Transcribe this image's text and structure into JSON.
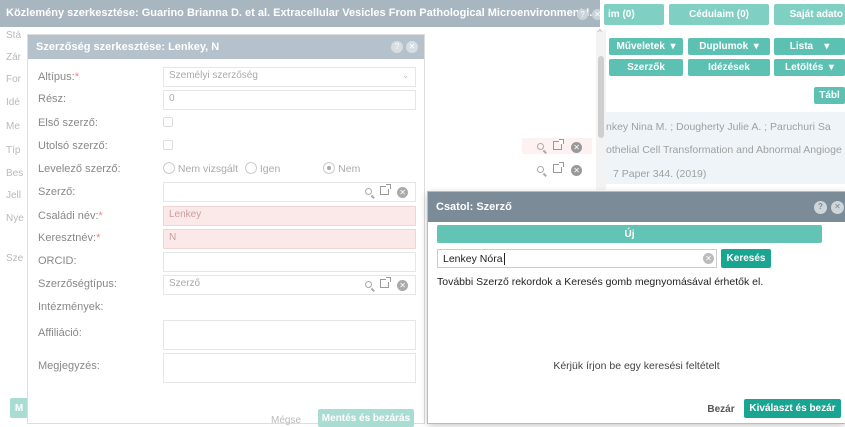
{
  "main_title": "Közlemény szerkesztése: Guarino Brianna D. et al. Extracellular Vesicles From Pathological Microenvironment I...",
  "top_tabs": [
    "im (0)",
    "Cédulaim (0)",
    "Saját adato"
  ],
  "toolbar_row1": [
    "Műveletek",
    "Duplumok",
    "Lista"
  ],
  "toolbar_row2": [
    "Szerzők",
    "Idézések",
    "Letöltés"
  ],
  "table_btn": "Tábl",
  "left_labels": [
    "Stá",
    "Zár",
    "For",
    "Idé",
    "Me",
    "Típ",
    "Bes",
    "Jell",
    "Nye",
    "Sze"
  ],
  "left_bottom_btn": "M",
  "content_lines": [
    "nkey Nina M. ;  Dougherty Julie A. ;  Paruchuri Sa",
    "othelial Cell Transformation and Abnormal Angioge",
    "7  Paper 344. (2019)"
  ],
  "author_dialog": {
    "title": "Szerzőség szerkesztése: Lenkey, N",
    "rows": {
      "altipus": {
        "label": "Altípus:",
        "value": "Személyi szerzőség"
      },
      "resz": {
        "label": "Rész:",
        "value": "0"
      },
      "elso": {
        "label": "Első szerző:"
      },
      "utolso": {
        "label": "Utolsó szerző:"
      },
      "levelezo": {
        "label": "Levelező szerző:",
        "options": [
          "Nem vizsgált",
          "Igen",
          "Nem"
        ]
      },
      "szerzo": {
        "label": "Szerző:"
      },
      "csaladi": {
        "label": "Családi név:",
        "value": "Lenkey"
      },
      "kereszt": {
        "label": "Keresztnév:",
        "value": "N"
      },
      "orcid": {
        "label": "ORCID:"
      },
      "tipus": {
        "label": "Szerzőségtípus:",
        "value": "Szerző"
      },
      "intezmeny": {
        "label": "Intézmények:"
      },
      "affil": {
        "label": "Affiliáció:"
      },
      "megjegyzes": {
        "label": "Megjegyzés:"
      }
    },
    "cancel": "Mégse",
    "save": "Mentés és bezárás"
  },
  "attach_dialog": {
    "title": "Csatol: Szerző",
    "new_btn": "Új",
    "search_value": "Lenkey Nóra",
    "search_btn": "Keresés",
    "info": "További Szerző rekordok a Keresés gomb megnyomásával érhetők el.",
    "empty": "Kérjük írjon be egy keresési feltételt",
    "close_btn": "Bezár",
    "select_btn": "Kiválaszt és bezár"
  },
  "colors": {
    "accent": "#1aa592",
    "header": "#7b8b98",
    "dialog_header": "#a8b6c0"
  }
}
